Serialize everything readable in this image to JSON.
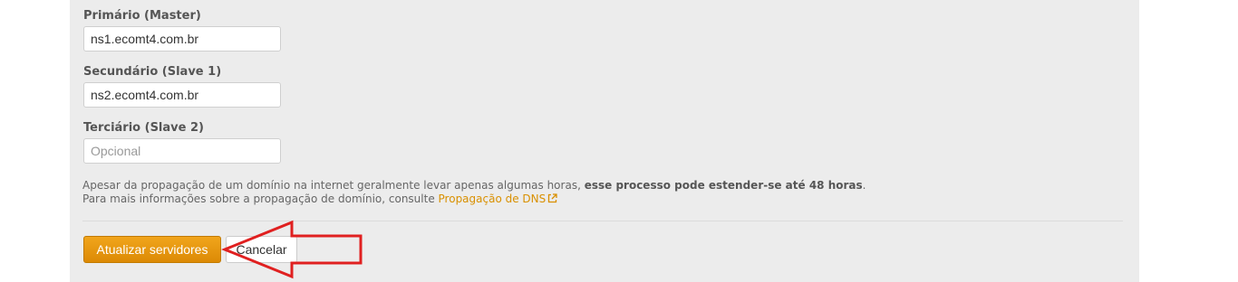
{
  "form": {
    "primary": {
      "label": "Primário (Master)",
      "value": "ns1.ecomt4.com.br",
      "placeholder": ""
    },
    "secondary": {
      "label": "Secundário (Slave 1)",
      "value": "ns2.ecomt4.com.br",
      "placeholder": ""
    },
    "tertiary": {
      "label": "Terciário (Slave 2)",
      "value": "",
      "placeholder": "Opcional"
    }
  },
  "info": {
    "line1_prefix": "Apesar da propagação de um domínio na internet geralmente levar apenas algumas horas, ",
    "line1_bold": "esse processo pode estender-se até 48 horas",
    "line1_suffix": ".",
    "line2_prefix": "Para mais informações sobre a propagação de domínio, consulte ",
    "link_text": "Propagação de DNS",
    "link_icon": "external-link-icon"
  },
  "actions": {
    "submit_label": "Atualizar servidores",
    "cancel_label": "Cancelar"
  },
  "annotation": {
    "icon": "red-arrow-annotation",
    "color": "#e02020"
  },
  "colors": {
    "panel_bg": "#ececec",
    "primary_button": "#e8980f",
    "link": "#d99000"
  }
}
